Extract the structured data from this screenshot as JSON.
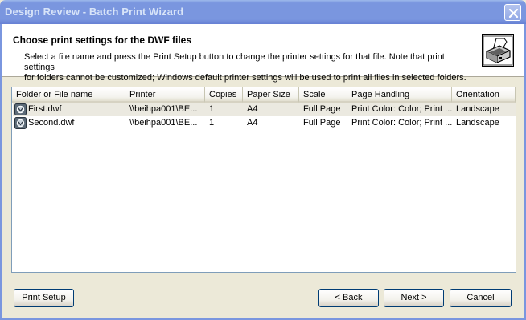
{
  "window": {
    "title": "Design Review - Batch Print Wizard"
  },
  "header": {
    "title": "Choose print settings for the DWF files",
    "description_line1": "Select a file name and press the Print Setup button to change the printer settings for that file. Note that print settings",
    "description_line2": "for folders cannot be customized; Windows default printer settings will be used to print all files in selected folders.",
    "icon": "printer-icon"
  },
  "table": {
    "columns": [
      "Folder or File name",
      "Printer",
      "Copies",
      "Paper Size",
      "Scale",
      "Page Handling",
      "Orientation"
    ],
    "rows": [
      {
        "name": "First.dwf",
        "printer": "\\\\beihpa001\\BE...",
        "copies": "1",
        "paper_size": "A4",
        "scale": "Full Page",
        "page_handling": "Print Color: Color; Print ...",
        "orientation": "Landscape"
      },
      {
        "name": "Second.dwf",
        "printer": "\\\\beihpa001\\BE...",
        "copies": "1",
        "paper_size": "A4",
        "scale": "Full Page",
        "page_handling": "Print Color: Color; Print ...",
        "orientation": "Landscape"
      }
    ]
  },
  "buttons": {
    "print_setup": "Print Setup",
    "back": "< Back",
    "next": "Next >",
    "cancel": "Cancel"
  },
  "colors": {
    "titlebar": "#7a96df",
    "dialog_face": "#ece9d8",
    "selected_row": "#ebe9e0"
  }
}
